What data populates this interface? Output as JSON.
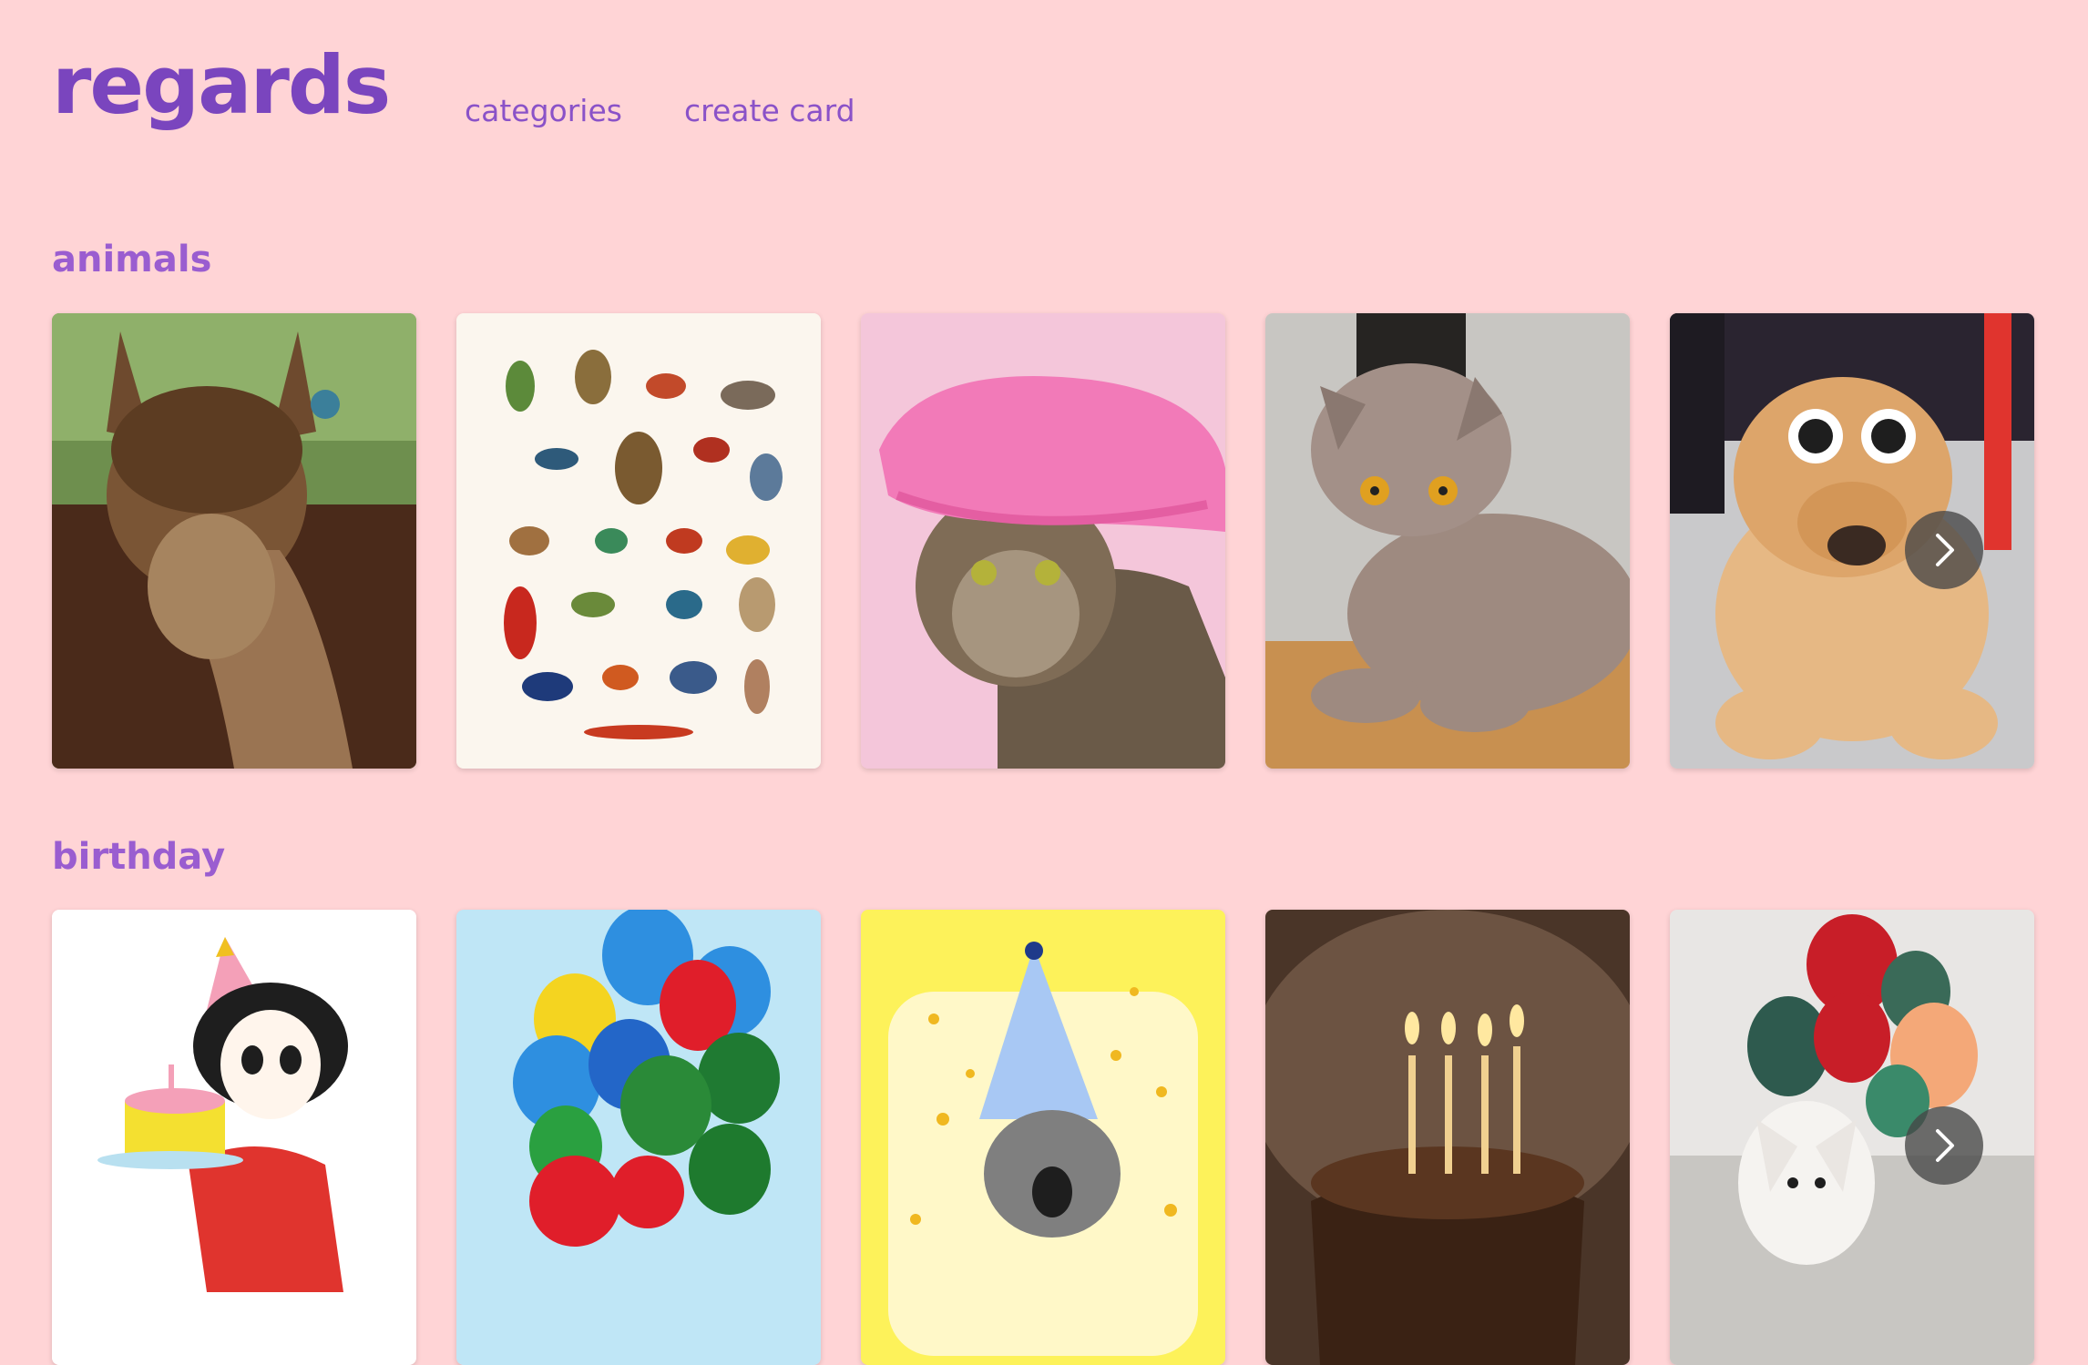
{
  "header": {
    "logo": "regards",
    "nav": [
      {
        "label": "categories"
      },
      {
        "label": "create card"
      }
    ]
  },
  "sections": [
    {
      "title": "animals",
      "cards": [
        {
          "image": "alpaca-photo"
        },
        {
          "image": "bird-illustration-chart"
        },
        {
          "image": "cat-in-pink-bonnet"
        },
        {
          "image": "grey-cat-lying"
        },
        {
          "image": "dog-with-sunglasses"
        }
      ]
    },
    {
      "title": "birthday",
      "cards": [
        {
          "image": "cartoon-girl-with-cake"
        },
        {
          "image": "balloon-bunch"
        },
        {
          "image": "cartoon-cat-party-hat"
        },
        {
          "image": "cake-with-candles"
        },
        {
          "image": "dog-with-balloons"
        }
      ]
    }
  ],
  "icons": {
    "next": "chevron-right-icon"
  },
  "colors": {
    "background": "#FFD4D6",
    "brand": "#7A45BE",
    "link": "#8A52C8"
  }
}
